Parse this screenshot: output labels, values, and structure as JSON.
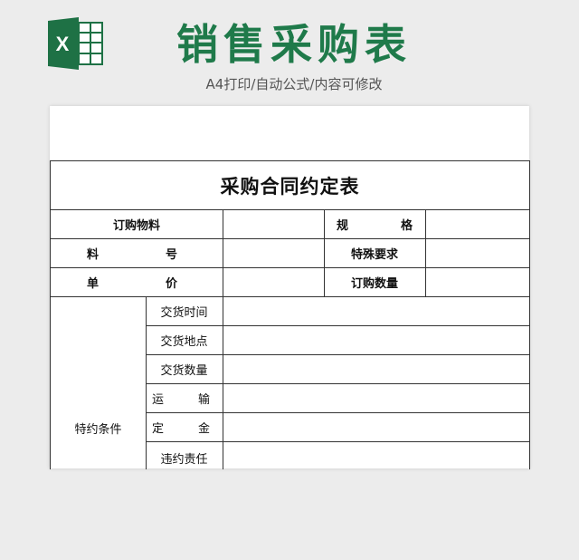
{
  "header": {
    "title": "销售采购表",
    "subtitle": "A4打印/自动公式/内容可修改",
    "logo_letter": "X"
  },
  "form": {
    "title": "采购合同约定表",
    "rows": [
      {
        "left_label": "订购物料",
        "right_label_a": "规",
        "right_label_b": "格"
      },
      {
        "left_label_a": "料",
        "left_label_b": "号",
        "right_label": "特殊要求"
      },
      {
        "left_label_a": "单",
        "left_label_b": "价",
        "right_label": "订购数量"
      }
    ],
    "special_terms": {
      "label": "特约条件",
      "items": [
        {
          "label": "交货时间"
        },
        {
          "label": "交货地点"
        },
        {
          "label": "交货数量"
        },
        {
          "label_a": "运",
          "label_b": "输"
        },
        {
          "label_a": "定",
          "label_b": "金"
        },
        {
          "label": "违约责任"
        }
      ]
    }
  },
  "colors": {
    "brand_green": "#1f7a4a",
    "logo_green": "#1e7145",
    "background": "#ececec"
  },
  "icons": [
    "excel-icon"
  ]
}
